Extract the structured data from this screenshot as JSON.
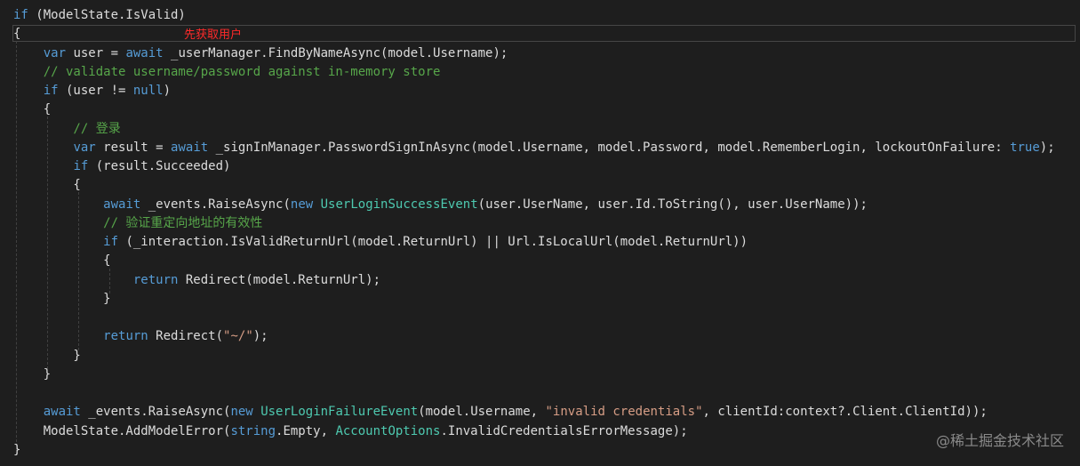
{
  "annotation": "先获取用户",
  "watermark": "@稀土掘金技术社区",
  "colors": {
    "background": "#1e1e1e",
    "text": "#dcdcdc",
    "keyword": "#569cd6",
    "type": "#4ec9b0",
    "string": "#d69d85",
    "comment": "#57a64a",
    "annotation": "#ff2a2a"
  },
  "code_lines": [
    [
      {
        "t": "if",
        "c": "kw"
      },
      {
        "t": " (ModelState.IsValid)",
        "c": ""
      }
    ],
    [
      {
        "t": "{",
        "c": ""
      }
    ],
    [
      {
        "t": "    ",
        "c": ""
      },
      {
        "t": "var",
        "c": "kw"
      },
      {
        "t": " user = ",
        "c": ""
      },
      {
        "t": "await",
        "c": "kw"
      },
      {
        "t": " _userManager.FindByNameAsync(model.Username);",
        "c": ""
      }
    ],
    [
      {
        "t": "    // validate username/password against in-memory store",
        "c": "cmt"
      }
    ],
    [
      {
        "t": "    ",
        "c": ""
      },
      {
        "t": "if",
        "c": "kw"
      },
      {
        "t": " (user != ",
        "c": ""
      },
      {
        "t": "null",
        "c": "kw"
      },
      {
        "t": ")",
        "c": ""
      }
    ],
    [
      {
        "t": "    {",
        "c": ""
      }
    ],
    [
      {
        "t": "        // 登录",
        "c": "cmt"
      }
    ],
    [
      {
        "t": "        ",
        "c": ""
      },
      {
        "t": "var",
        "c": "kw"
      },
      {
        "t": " result = ",
        "c": ""
      },
      {
        "t": "await",
        "c": "kw"
      },
      {
        "t": " _signInManager.PasswordSignInAsync(model.Username, model.Password, model.RememberLogin, lockoutOnFailure: ",
        "c": ""
      },
      {
        "t": "true",
        "c": "kw"
      },
      {
        "t": ");",
        "c": ""
      }
    ],
    [
      {
        "t": "        ",
        "c": ""
      },
      {
        "t": "if",
        "c": "kw"
      },
      {
        "t": " (result.Succeeded)",
        "c": ""
      }
    ],
    [
      {
        "t": "        {",
        "c": ""
      }
    ],
    [
      {
        "t": "            ",
        "c": ""
      },
      {
        "t": "await",
        "c": "kw"
      },
      {
        "t": " _events.RaiseAsync(",
        "c": ""
      },
      {
        "t": "new",
        "c": "kw"
      },
      {
        "t": " ",
        "c": ""
      },
      {
        "t": "UserLoginSuccessEvent",
        "c": "type"
      },
      {
        "t": "(user.UserName, user.Id.ToString(), user.UserName));",
        "c": ""
      }
    ],
    [
      {
        "t": "            // 验证重定向地址的有效性",
        "c": "cmt"
      }
    ],
    [
      {
        "t": "            ",
        "c": ""
      },
      {
        "t": "if",
        "c": "kw"
      },
      {
        "t": " (_interaction.IsValidReturnUrl(model.ReturnUrl) || Url.IsLocalUrl(model.ReturnUrl))",
        "c": ""
      }
    ],
    [
      {
        "t": "            {",
        "c": ""
      }
    ],
    [
      {
        "t": "                ",
        "c": ""
      },
      {
        "t": "return",
        "c": "kw"
      },
      {
        "t": " Redirect(model.ReturnUrl);",
        "c": ""
      }
    ],
    [
      {
        "t": "            }",
        "c": ""
      }
    ],
    [
      {
        "t": "",
        "c": ""
      }
    ],
    [
      {
        "t": "            ",
        "c": ""
      },
      {
        "t": "return",
        "c": "kw"
      },
      {
        "t": " Redirect(",
        "c": ""
      },
      {
        "t": "\"~/\"",
        "c": "str"
      },
      {
        "t": ");",
        "c": ""
      }
    ],
    [
      {
        "t": "        }",
        "c": ""
      }
    ],
    [
      {
        "t": "    }",
        "c": ""
      }
    ],
    [
      {
        "t": "",
        "c": ""
      }
    ],
    [
      {
        "t": "    ",
        "c": ""
      },
      {
        "t": "await",
        "c": "kw"
      },
      {
        "t": " _events.RaiseAsync(",
        "c": ""
      },
      {
        "t": "new",
        "c": "kw"
      },
      {
        "t": " ",
        "c": ""
      },
      {
        "t": "UserLoginFailureEvent",
        "c": "type"
      },
      {
        "t": "(model.Username, ",
        "c": ""
      },
      {
        "t": "\"invalid credentials\"",
        "c": "str"
      },
      {
        "t": ", clientId:context?.Client.ClientId));",
        "c": ""
      }
    ],
    [
      {
        "t": "    ModelState.AddModelError(",
        "c": ""
      },
      {
        "t": "string",
        "c": "kw"
      },
      {
        "t": ".Empty, ",
        "c": ""
      },
      {
        "t": "AccountOptions",
        "c": "type"
      },
      {
        "t": ".InvalidCredentialsErrorMessage);",
        "c": ""
      }
    ],
    [
      {
        "t": "}",
        "c": ""
      }
    ]
  ]
}
